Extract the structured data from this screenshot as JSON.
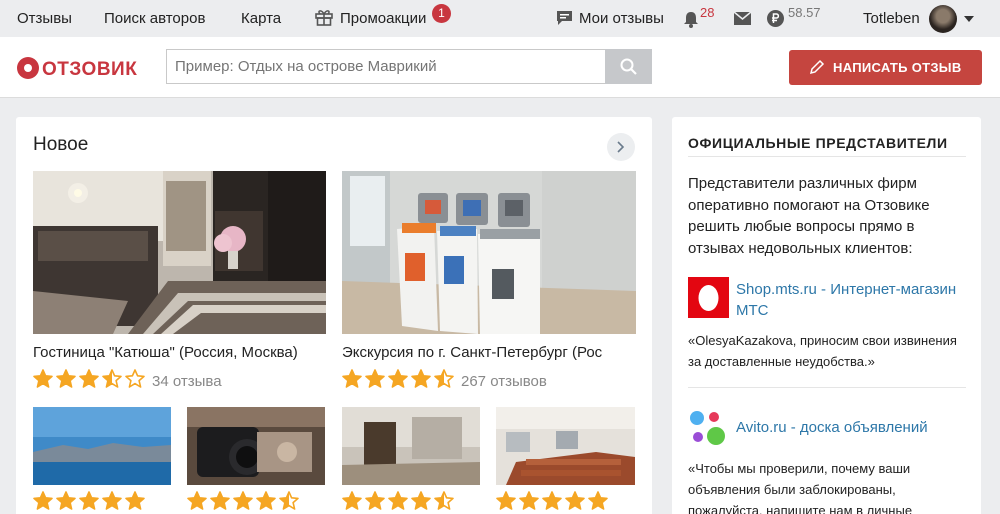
{
  "topnav": {
    "items": [
      {
        "label": "Отзывы"
      },
      {
        "label": "Поиск авторов"
      },
      {
        "label": "Карта"
      },
      {
        "label": "Промоакции",
        "badge": "1"
      }
    ],
    "my_reviews": "Мои отзывы",
    "notifications_count": "28",
    "balance": "58.57",
    "username": "Totleben"
  },
  "header": {
    "logo_text": "ОТЗОВИК",
    "search_placeholder": "Пример: Отдых на острове Маврикий",
    "write_button": "НАПИСАТЬ ОТЗЫВ"
  },
  "main": {
    "title": "Новое",
    "items": [
      {
        "title": "Гостиница \"Катюша\" (Россия, Москва)",
        "rating": 3.5,
        "reviews": "34 отзыва"
      },
      {
        "title": "Экскурсия по г. Санкт-Петербург (Рос",
        "rating": 4.5,
        "reviews": "267 отзывов"
      },
      {
        "rating": 5
      },
      {
        "rating": 4.5
      },
      {
        "rating": 4.5
      },
      {
        "rating": 5
      }
    ]
  },
  "sidebar": {
    "title": "ОФИЦИАЛЬНЫЕ ПРЕДСТАВИТЕЛИ",
    "description": "Представители различных фирм оперативно помогают на Отзовике решить любые вопросы прямо в отзывах недовольных клиентов:",
    "reps": [
      {
        "name": "Shop.mts.ru - Интернет-магазин МТС",
        "quote": "«OlesyaKazakova, приносим свои извинения за доставленные неудобства.»"
      },
      {
        "name": "Avito.ru - доска объявлений",
        "quote": "«Чтобы мы проверили, почему ваши объявления были заблокированы, пожалуйста, напишите нам в личные"
      }
    ]
  },
  "colors": {
    "accent": "#c5453f",
    "star": "#f5a623",
    "link": "#2d77a8"
  }
}
